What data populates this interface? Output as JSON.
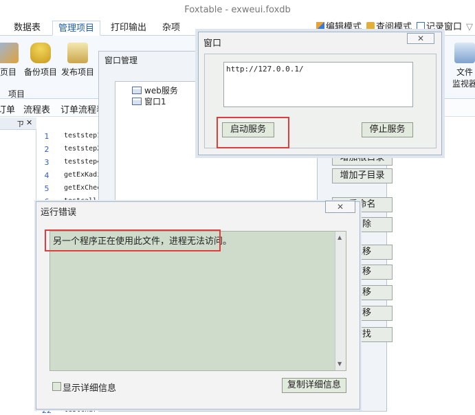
{
  "app": {
    "title": "Foxtable - exweui.foxdb"
  },
  "ribbon_tabs": [
    "数据表",
    "管理项目",
    "打印输出",
    "杂项"
  ],
  "modes": {
    "edit": "编辑模式",
    "view": "查阅模式",
    "record": "记录窗口"
  },
  "ribbon": {
    "buttons": [
      "页目",
      "备份项目",
      "发布项目"
    ],
    "group_label": "项目",
    "right_button": "文件",
    "right_button2": "监视器"
  },
  "sub_tabs": [
    "订单",
    "流程表",
    "订单流程表"
  ],
  "left_pane": {
    "pin": "ㄗ",
    "close": "✕"
  },
  "code_list": [
    {
      "n": "1",
      "t": "teststep1"
    },
    {
      "n": "2",
      "t": "teststep2"
    },
    {
      "n": "3",
      "t": "teststep4"
    },
    {
      "n": "4",
      "t": "getExKadi"
    },
    {
      "n": "5",
      "t": "getExCheck"
    },
    {
      "n": "6",
      "t": "testcall"
    }
  ],
  "code_list_tail": {
    "n": "22",
    "t": "testchart"
  },
  "window_manager": {
    "title": "窗口管理",
    "tree": [
      "web服务",
      "窗口1"
    ],
    "buttons": [
      "增加根目录",
      "增加子目录",
      "重命名",
      "删除",
      "上移",
      "下移",
      "左移",
      "右移",
      "查找"
    ]
  },
  "popup": {
    "title": "窗口",
    "url": "http://127.0.0.1/",
    "start_button": "启动服务",
    "stop_button": "停止服务"
  },
  "error_dialog": {
    "title": "运行错误",
    "message": "另一个程序正在使用此文件，进程无法访问。",
    "show_details": "显示详细信息",
    "copy_details": "复制详细信息"
  },
  "colors": {
    "highlight": "#e03c3c",
    "accent": "#1f5ea8"
  }
}
